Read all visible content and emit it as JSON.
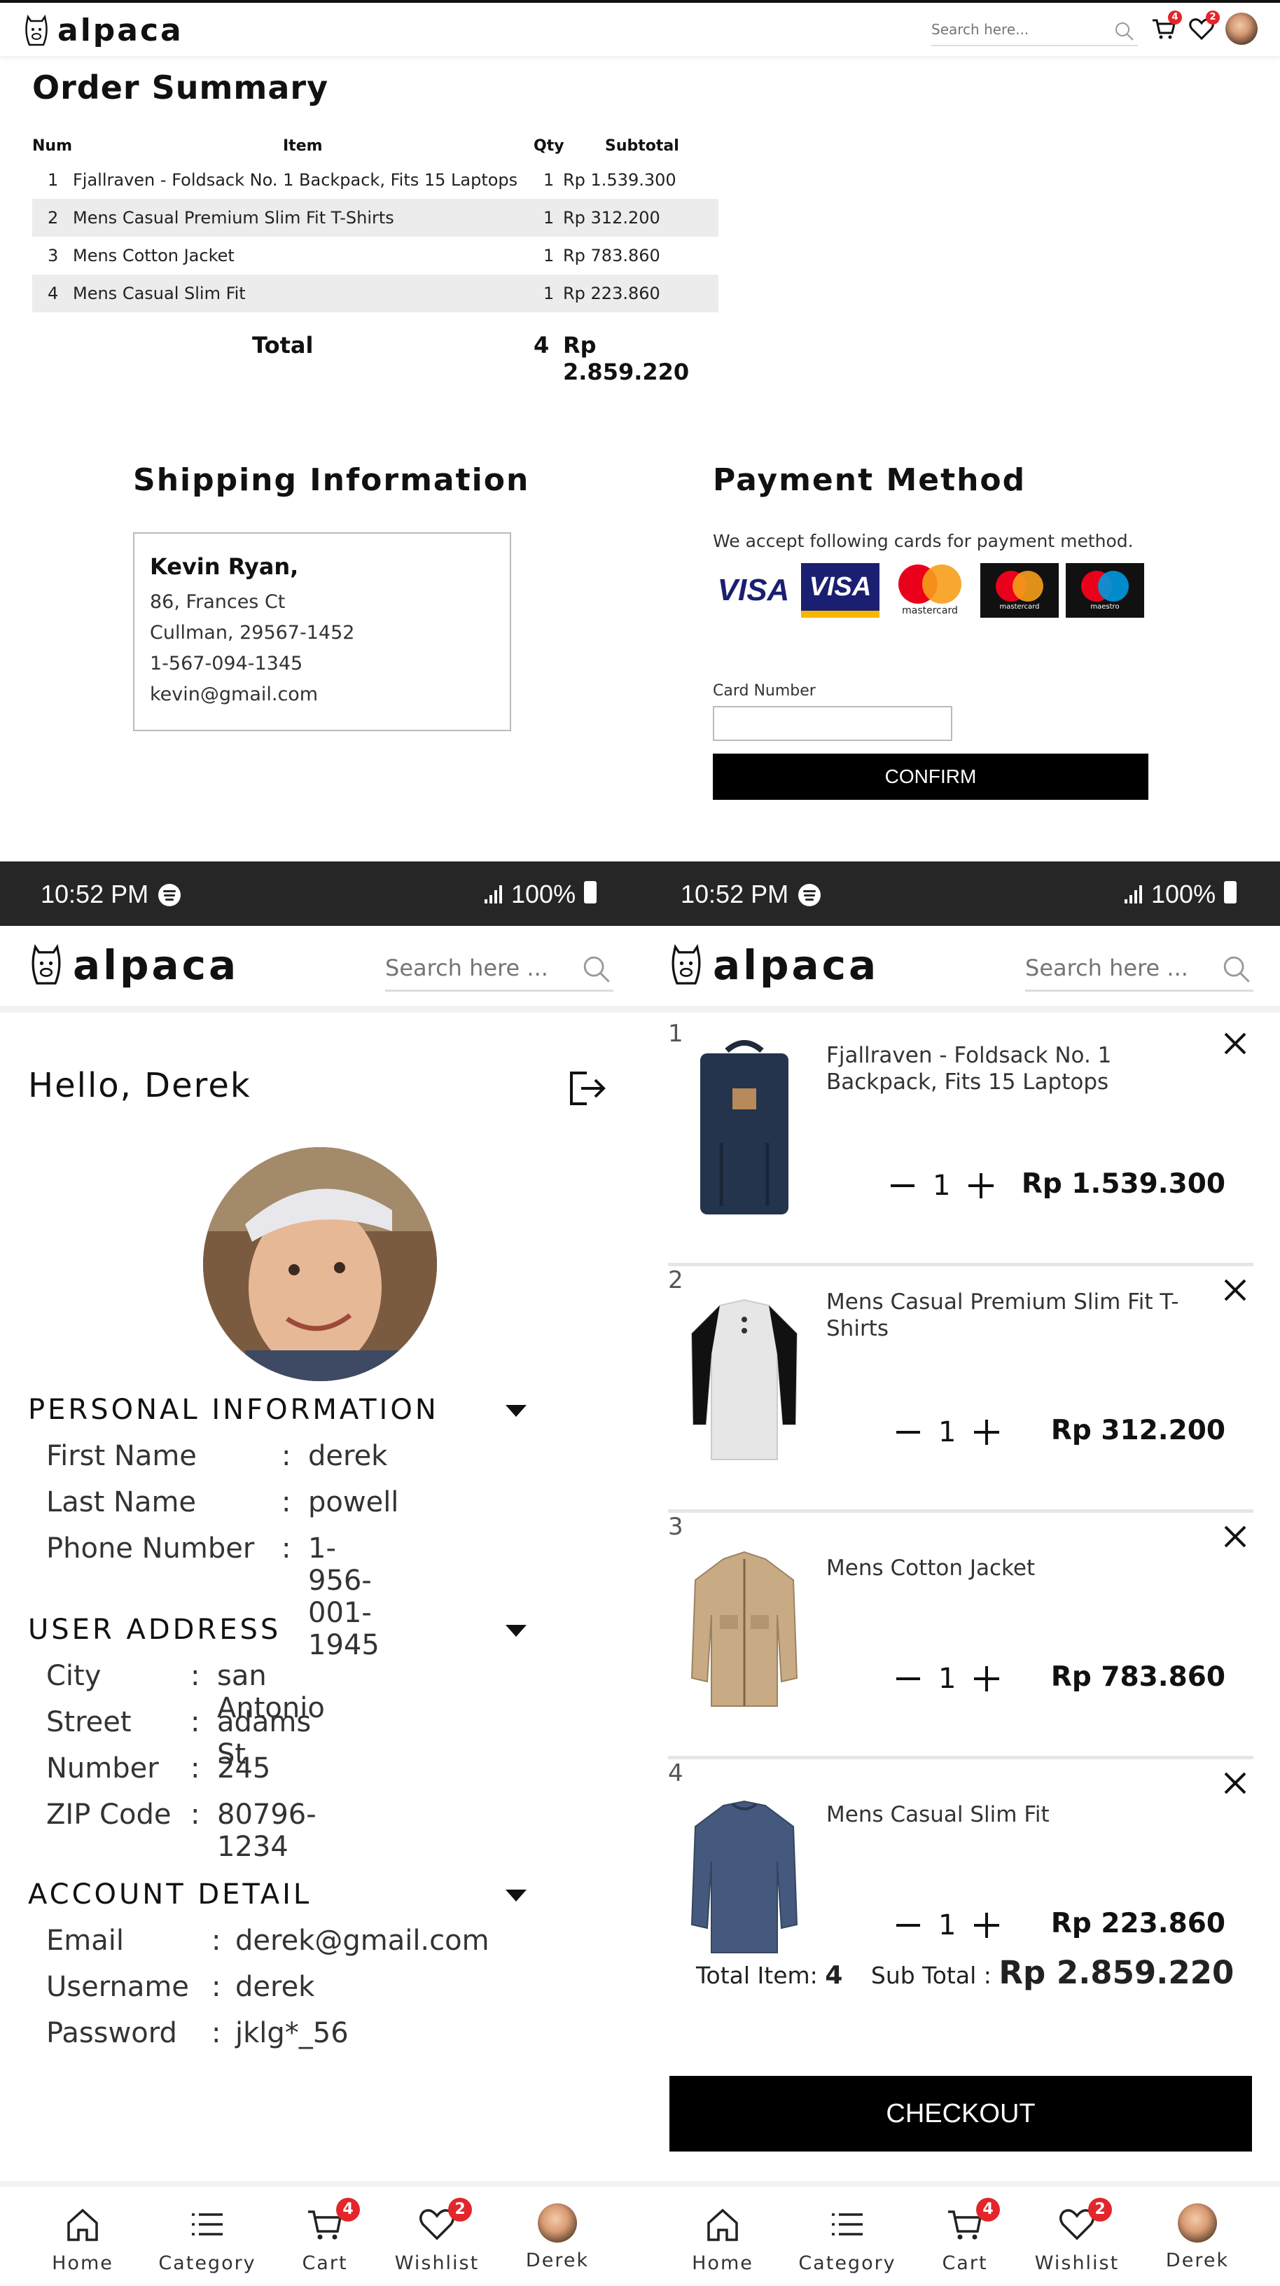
{
  "app": {
    "brand": "alpaca"
  },
  "desktop": {
    "search_placeholder": "Search here...",
    "cart_badge": "4",
    "wishlist_badge": "2",
    "order_summary": {
      "title": "Order Summary",
      "columns": [
        "Num",
        "Item",
        "Qty",
        "Subtotal"
      ],
      "rows": [
        {
          "num": "1",
          "item": "Fjallraven - Foldsack No. 1 Backpack, Fits 15 Laptops",
          "qty": "1",
          "subtotal": "Rp 1.539.300"
        },
        {
          "num": "2",
          "item": "Mens Casual Premium Slim Fit T-Shirts",
          "qty": "1",
          "subtotal": "Rp 312.200"
        },
        {
          "num": "3",
          "item": "Mens Cotton Jacket",
          "qty": "1",
          "subtotal": "Rp 783.860"
        },
        {
          "num": "4",
          "item": "Mens Casual Slim Fit",
          "qty": "1",
          "subtotal": "Rp 223.860"
        }
      ],
      "total_label": "Total",
      "total_qty": "4",
      "total_amount": "Rp 2.859.220"
    },
    "shipping": {
      "title": "Shipping Information",
      "name": "Kevin Ryan,",
      "lines": [
        "86, Frances Ct",
        "Cullman, 29567-1452",
        "1-567-094-1345",
        "kevin@gmail.com"
      ]
    },
    "payment": {
      "title": "Payment Method",
      "note": "We accept following cards for payment method.",
      "cards": [
        "VISA",
        "VISA",
        "mastercard",
        "mastercard",
        "maestro"
      ],
      "card_number_label": "Card Number",
      "card_number_value": "",
      "confirm_label": "CONFIRM"
    }
  },
  "mobile": {
    "status": {
      "time": "10:52 PM",
      "battery": "100%"
    },
    "search_placeholder": "Search here ...",
    "profile": {
      "greeting": "Hello, Derek",
      "sections": [
        {
          "title": "PERSONAL INFORMATION",
          "fields": [
            {
              "label": "First Name",
              "value": "derek"
            },
            {
              "label": "Last Name",
              "value": "powell"
            },
            {
              "label": "Phone Number",
              "value": "1-956-001-1945"
            }
          ]
        },
        {
          "title": "USER ADDRESS",
          "fields": [
            {
              "label": "City",
              "value": "san Antonio"
            },
            {
              "label": "Street",
              "value": "adams St"
            },
            {
              "label": "Number",
              "value": "245"
            },
            {
              "label": "ZIP Code",
              "value": "80796-1234"
            }
          ]
        },
        {
          "title": "ACCOUNT DETAIL",
          "fields": [
            {
              "label": "Email",
              "value": "derek@gmail.com"
            },
            {
              "label": "Username",
              "value": "derek"
            },
            {
              "label": "Password",
              "value": "jklg*_56"
            }
          ]
        }
      ]
    },
    "cart": {
      "items": [
        {
          "num": "1",
          "name": "Fjallraven - Foldsack No. 1 Backpack, Fits 15 Laptops",
          "qty": "1",
          "price": "Rp 1.539.300"
        },
        {
          "num": "2",
          "name": "Mens Casual Premium Slim Fit T-Shirts",
          "qty": "1",
          "price": "Rp 312.200"
        },
        {
          "num": "3",
          "name": "Mens Cotton Jacket",
          "qty": "1",
          "price": "Rp 783.860"
        },
        {
          "num": "4",
          "name": "Mens Casual Slim Fit",
          "qty": "1",
          "price": "Rp 223.860"
        }
      ],
      "total_item_label": "Total Item:",
      "total_item_value": "4",
      "sub_total_label": "Sub Total :",
      "sub_total_value": "Rp 2.859.220",
      "checkout_label": "CHECKOUT"
    },
    "nav": {
      "items": [
        {
          "label": "Home",
          "icon": "home-icon"
        },
        {
          "label": "Category",
          "icon": "list-icon"
        },
        {
          "label": "Cart",
          "icon": "cart-icon",
          "badge": "4"
        },
        {
          "label": "Wishlist",
          "icon": "heart-icon",
          "badge": "2"
        },
        {
          "label": "Derek",
          "icon": "avatar"
        }
      ]
    }
  }
}
